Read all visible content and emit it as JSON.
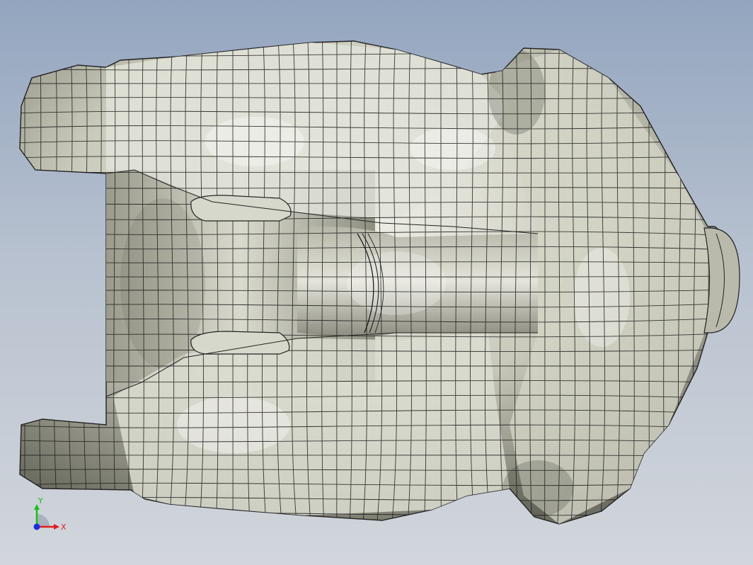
{
  "viewport": {
    "background_top": "#93a5bf",
    "background_bottom": "#d2d6dc",
    "model_fill": "#d8d9cc",
    "mesh_color": "#1a1a1a"
  },
  "triad": {
    "x_label": "X",
    "y_label": "Y",
    "x_color": "#e01b1b",
    "y_color": "#18c018",
    "z_color": "#1b2ee0"
  }
}
